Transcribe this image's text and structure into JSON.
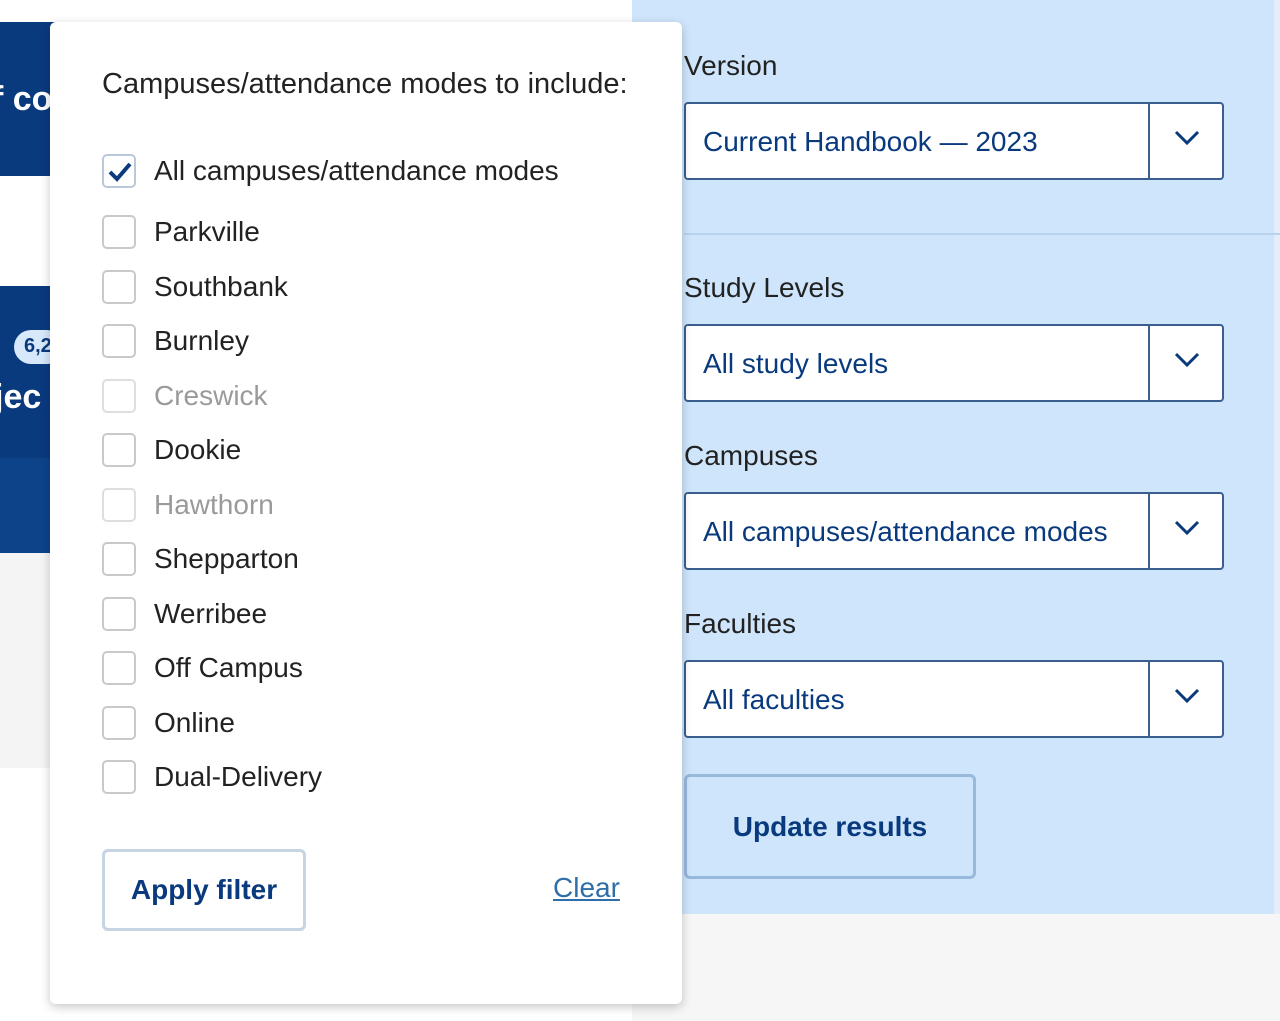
{
  "background": {
    "fragment_top": "f co",
    "fragment_badge": "6,2",
    "fragment_mid": "jec"
  },
  "popup": {
    "title": "Campuses/attendance modes to include:",
    "options": [
      {
        "label": "All campuses/attendance modes",
        "checked": true,
        "disabled": false
      },
      {
        "label": "Parkville",
        "checked": false,
        "disabled": false
      },
      {
        "label": "Southbank",
        "checked": false,
        "disabled": false
      },
      {
        "label": "Burnley",
        "checked": false,
        "disabled": false
      },
      {
        "label": "Creswick",
        "checked": false,
        "disabled": true
      },
      {
        "label": "Dookie",
        "checked": false,
        "disabled": false
      },
      {
        "label": "Hawthorn",
        "checked": false,
        "disabled": true
      },
      {
        "label": "Shepparton",
        "checked": false,
        "disabled": false
      },
      {
        "label": "Werribee",
        "checked": false,
        "disabled": false
      },
      {
        "label": "Off Campus",
        "checked": false,
        "disabled": false
      },
      {
        "label": "Online",
        "checked": false,
        "disabled": false
      },
      {
        "label": "Dual-Delivery",
        "checked": false,
        "disabled": false
      }
    ],
    "apply_label": "Apply filter",
    "clear_label": "Clear"
  },
  "filters": {
    "version": {
      "label": "Version",
      "value": "Current Handbook — 2023"
    },
    "study_levels": {
      "label": "Study Levels",
      "value": "All study levels"
    },
    "campuses": {
      "label": "Campuses",
      "value": "All campuses/attendance modes"
    },
    "faculties": {
      "label": "Faculties",
      "value": "All faculties"
    },
    "update_label": "Update results"
  },
  "colors": {
    "navy": "#0a3a7e",
    "panel_blue": "#cfe5fb",
    "link": "#2f6ea8"
  }
}
